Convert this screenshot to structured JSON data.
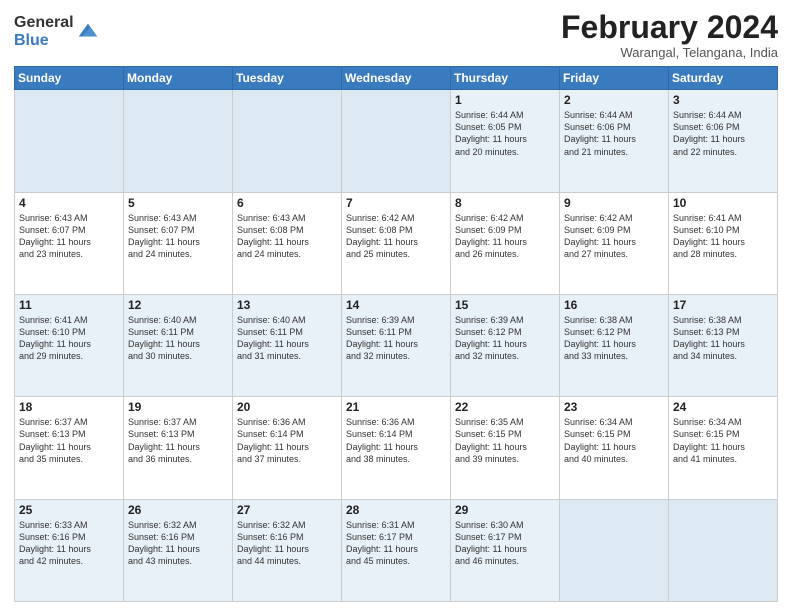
{
  "logo": {
    "general": "General",
    "blue": "Blue"
  },
  "title": "February 2024",
  "location": "Warangal, Telangana, India",
  "days_of_week": [
    "Sunday",
    "Monday",
    "Tuesday",
    "Wednesday",
    "Thursday",
    "Friday",
    "Saturday"
  ],
  "weeks": [
    [
      {
        "day": "",
        "info": ""
      },
      {
        "day": "",
        "info": ""
      },
      {
        "day": "",
        "info": ""
      },
      {
        "day": "",
        "info": ""
      },
      {
        "day": "1",
        "info": "Sunrise: 6:44 AM\nSunset: 6:05 PM\nDaylight: 11 hours\nand 20 minutes."
      },
      {
        "day": "2",
        "info": "Sunrise: 6:44 AM\nSunset: 6:06 PM\nDaylight: 11 hours\nand 21 minutes."
      },
      {
        "day": "3",
        "info": "Sunrise: 6:44 AM\nSunset: 6:06 PM\nDaylight: 11 hours\nand 22 minutes."
      }
    ],
    [
      {
        "day": "4",
        "info": "Sunrise: 6:43 AM\nSunset: 6:07 PM\nDaylight: 11 hours\nand 23 minutes."
      },
      {
        "day": "5",
        "info": "Sunrise: 6:43 AM\nSunset: 6:07 PM\nDaylight: 11 hours\nand 24 minutes."
      },
      {
        "day": "6",
        "info": "Sunrise: 6:43 AM\nSunset: 6:08 PM\nDaylight: 11 hours\nand 24 minutes."
      },
      {
        "day": "7",
        "info": "Sunrise: 6:42 AM\nSunset: 6:08 PM\nDaylight: 11 hours\nand 25 minutes."
      },
      {
        "day": "8",
        "info": "Sunrise: 6:42 AM\nSunset: 6:09 PM\nDaylight: 11 hours\nand 26 minutes."
      },
      {
        "day": "9",
        "info": "Sunrise: 6:42 AM\nSunset: 6:09 PM\nDaylight: 11 hours\nand 27 minutes."
      },
      {
        "day": "10",
        "info": "Sunrise: 6:41 AM\nSunset: 6:10 PM\nDaylight: 11 hours\nand 28 minutes."
      }
    ],
    [
      {
        "day": "11",
        "info": "Sunrise: 6:41 AM\nSunset: 6:10 PM\nDaylight: 11 hours\nand 29 minutes."
      },
      {
        "day": "12",
        "info": "Sunrise: 6:40 AM\nSunset: 6:11 PM\nDaylight: 11 hours\nand 30 minutes."
      },
      {
        "day": "13",
        "info": "Sunrise: 6:40 AM\nSunset: 6:11 PM\nDaylight: 11 hours\nand 31 minutes."
      },
      {
        "day": "14",
        "info": "Sunrise: 6:39 AM\nSunset: 6:11 PM\nDaylight: 11 hours\nand 32 minutes."
      },
      {
        "day": "15",
        "info": "Sunrise: 6:39 AM\nSunset: 6:12 PM\nDaylight: 11 hours\nand 32 minutes."
      },
      {
        "day": "16",
        "info": "Sunrise: 6:38 AM\nSunset: 6:12 PM\nDaylight: 11 hours\nand 33 minutes."
      },
      {
        "day": "17",
        "info": "Sunrise: 6:38 AM\nSunset: 6:13 PM\nDaylight: 11 hours\nand 34 minutes."
      }
    ],
    [
      {
        "day": "18",
        "info": "Sunrise: 6:37 AM\nSunset: 6:13 PM\nDaylight: 11 hours\nand 35 minutes."
      },
      {
        "day": "19",
        "info": "Sunrise: 6:37 AM\nSunset: 6:13 PM\nDaylight: 11 hours\nand 36 minutes."
      },
      {
        "day": "20",
        "info": "Sunrise: 6:36 AM\nSunset: 6:14 PM\nDaylight: 11 hours\nand 37 minutes."
      },
      {
        "day": "21",
        "info": "Sunrise: 6:36 AM\nSunset: 6:14 PM\nDaylight: 11 hours\nand 38 minutes."
      },
      {
        "day": "22",
        "info": "Sunrise: 6:35 AM\nSunset: 6:15 PM\nDaylight: 11 hours\nand 39 minutes."
      },
      {
        "day": "23",
        "info": "Sunrise: 6:34 AM\nSunset: 6:15 PM\nDaylight: 11 hours\nand 40 minutes."
      },
      {
        "day": "24",
        "info": "Sunrise: 6:34 AM\nSunset: 6:15 PM\nDaylight: 11 hours\nand 41 minutes."
      }
    ],
    [
      {
        "day": "25",
        "info": "Sunrise: 6:33 AM\nSunset: 6:16 PM\nDaylight: 11 hours\nand 42 minutes."
      },
      {
        "day": "26",
        "info": "Sunrise: 6:32 AM\nSunset: 6:16 PM\nDaylight: 11 hours\nand 43 minutes."
      },
      {
        "day": "27",
        "info": "Sunrise: 6:32 AM\nSunset: 6:16 PM\nDaylight: 11 hours\nand 44 minutes."
      },
      {
        "day": "28",
        "info": "Sunrise: 6:31 AM\nSunset: 6:17 PM\nDaylight: 11 hours\nand 45 minutes."
      },
      {
        "day": "29",
        "info": "Sunrise: 6:30 AM\nSunset: 6:17 PM\nDaylight: 11 hours\nand 46 minutes."
      },
      {
        "day": "",
        "info": ""
      },
      {
        "day": "",
        "info": ""
      }
    ]
  ]
}
